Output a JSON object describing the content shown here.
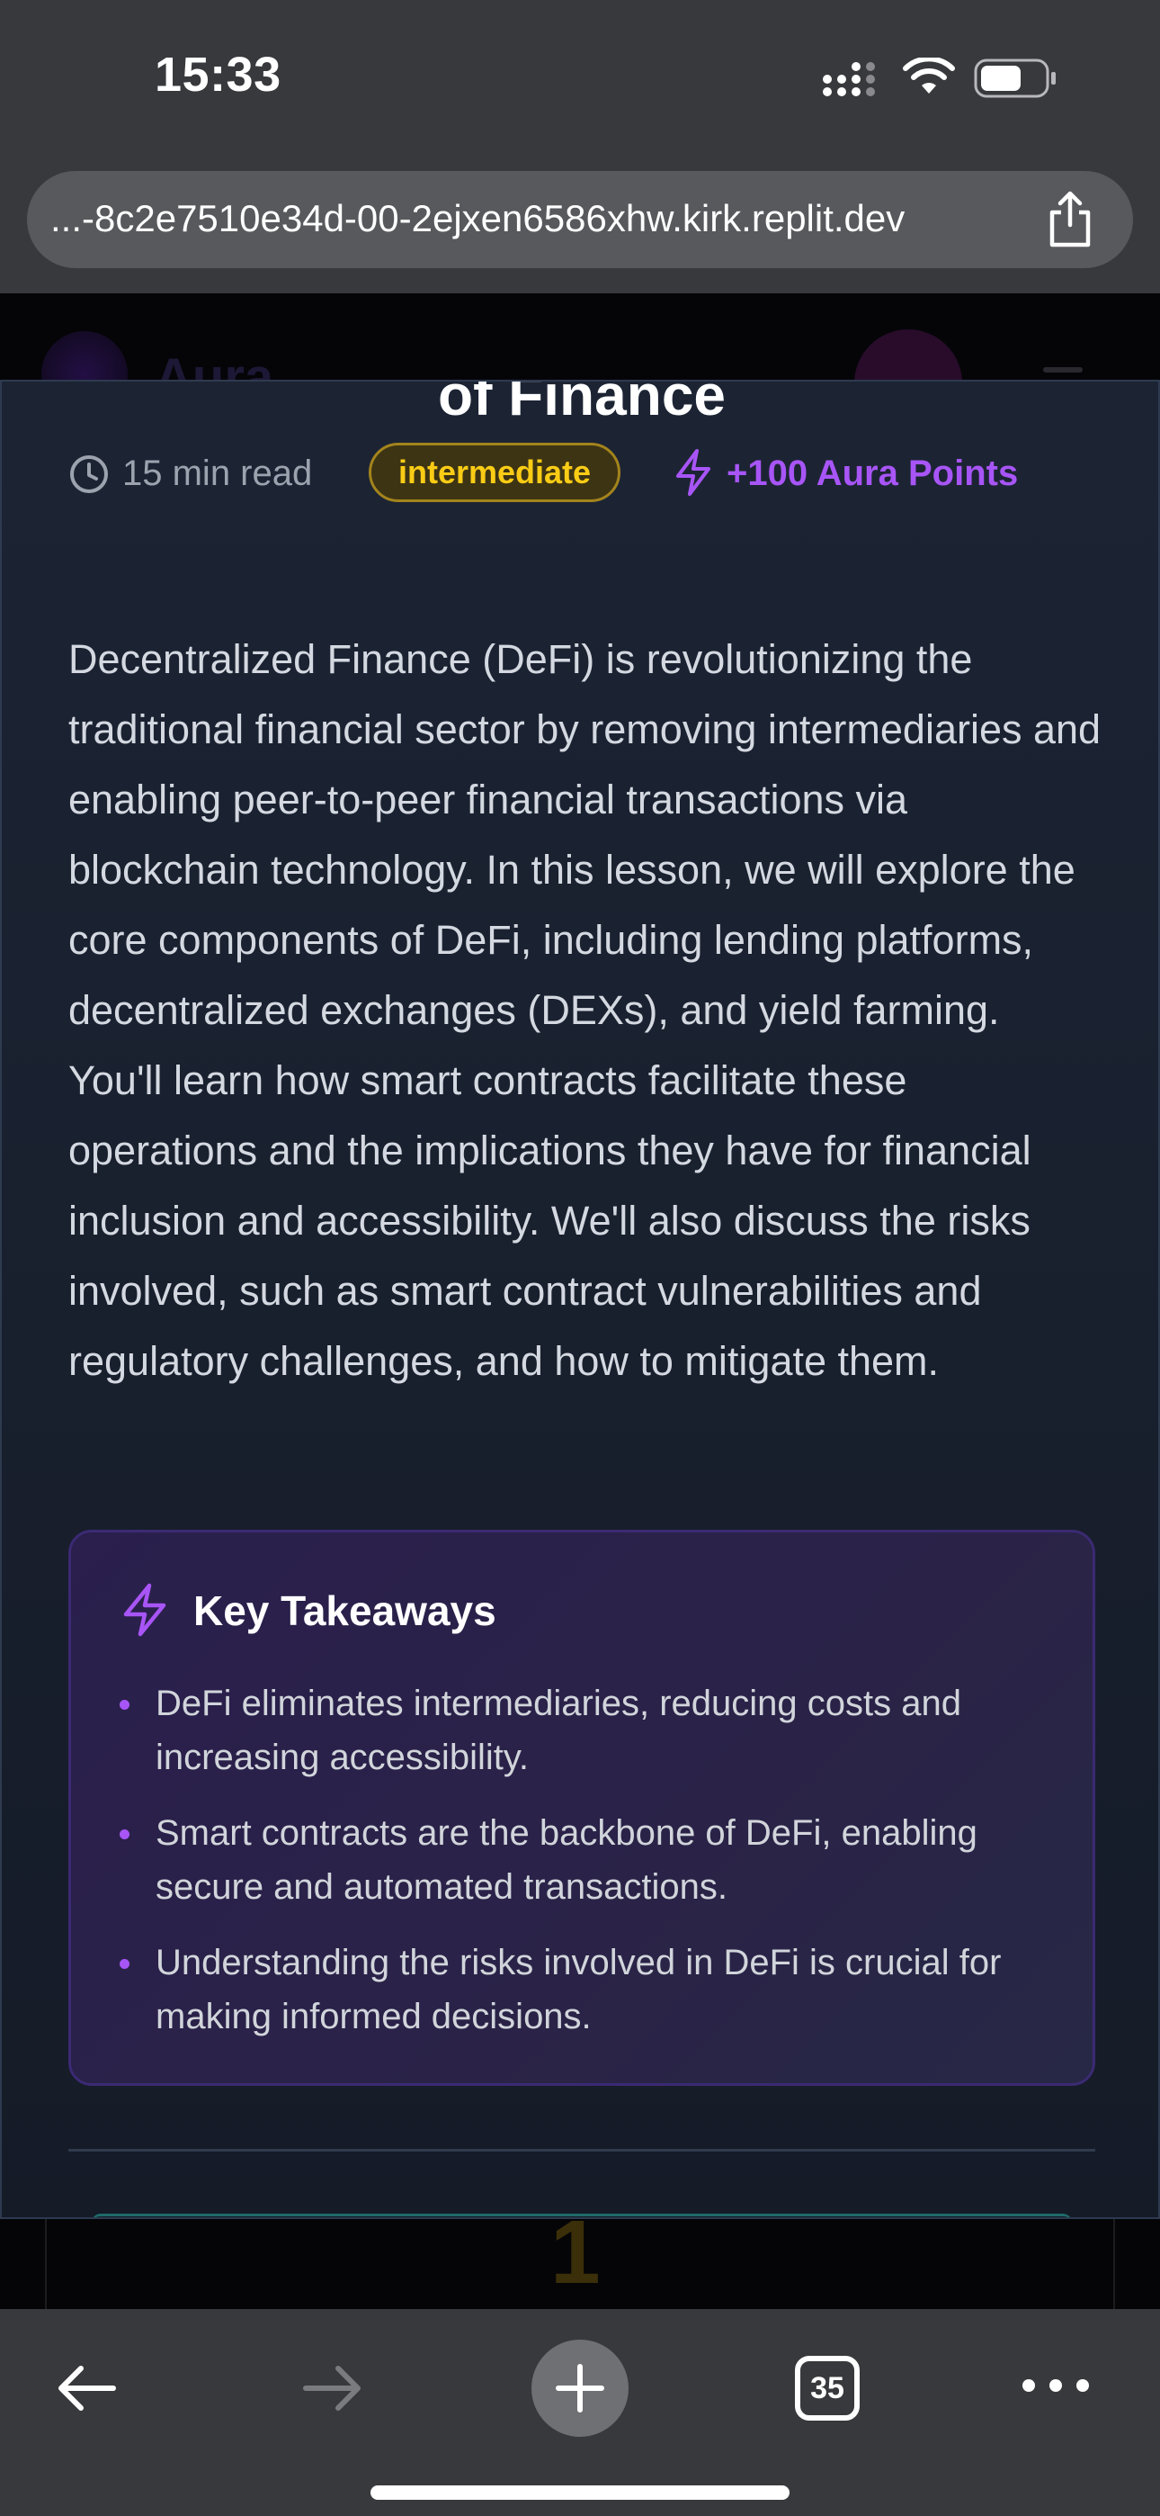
{
  "status_bar": {
    "time": "15:33"
  },
  "browser": {
    "url": "...-8c2e7510e34d-00-2ejxen6586xhw.kirk.replit.dev",
    "tab_count": "35"
  },
  "site": {
    "name": "Aura"
  },
  "background": {
    "step_number": "1"
  },
  "lesson": {
    "title": "of Finance",
    "read_time": "15 min read",
    "level": "intermediate",
    "points": "+100 Aura Points",
    "body": "Decentralized Finance (DeFi) is revolutionizing the traditional financial sector by removing intermediaries and enabling peer-to-peer financial transactions via blockchain technology. In this lesson, we will explore the core components of DeFi, including lending platforms, decentralized exchanges (DEXs), and yield farming. You'll learn how smart contracts facilitate these operations and the implications they have for financial inclusion and accessibility. We'll also discuss the risks involved, such as smart contract vulnerabilities and regulatory challenges, and how to mitigate them.",
    "takeaways": {
      "title": "Key Takeaways",
      "items": [
        "DeFi eliminates intermediaries, reducing costs and increasing accessibility.",
        "Smart contracts are the backbone of DeFi, enabling secure and automated transactions.",
        "Understanding the risks involved in DeFi is crucial for making informed decisions."
      ]
    }
  },
  "colors": {
    "accent_purple": "#a855f7",
    "badge_yellow": "#facc15",
    "modal_bg": "#1c2434"
  },
  "icons": {
    "status": [
      "signal-icon",
      "wifi-icon",
      "battery-icon"
    ],
    "toolbar": [
      "back-arrow-icon",
      "forward-arrow-icon",
      "plus-icon",
      "tabs-icon",
      "more-icon"
    ],
    "lesson": [
      "clock-icon",
      "lightning-bolt-icon"
    ]
  }
}
